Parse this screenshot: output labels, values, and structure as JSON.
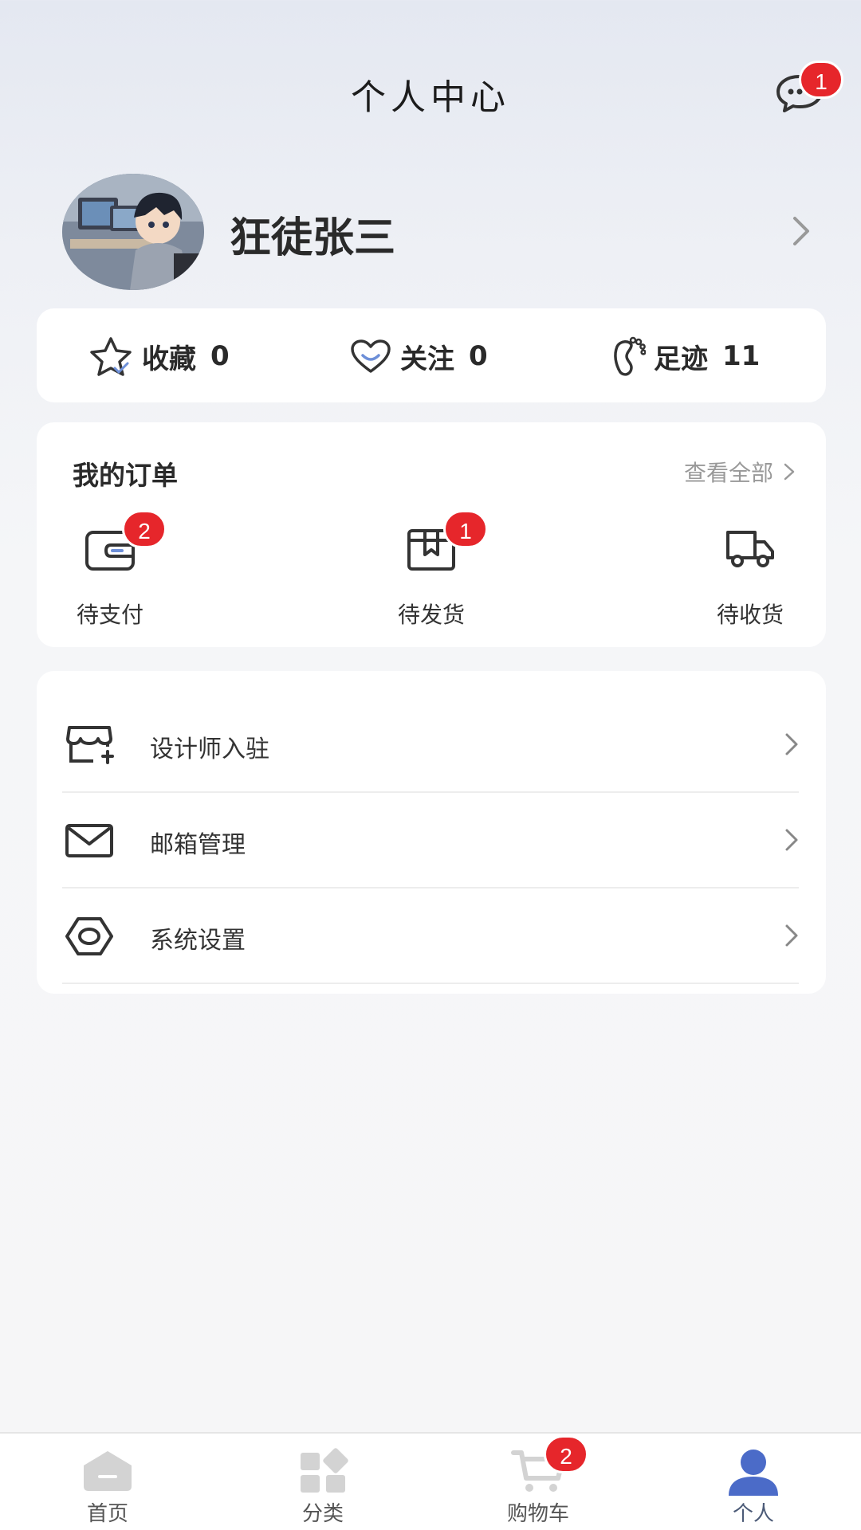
{
  "header": {
    "title": "个人中心",
    "message_badge": "1"
  },
  "profile": {
    "username": "狂徒张三"
  },
  "stats": [
    {
      "label": "收藏",
      "value": "0",
      "icon": "star-icon"
    },
    {
      "label": "关注",
      "value": "0",
      "icon": "heart-icon"
    },
    {
      "label": "足迹",
      "value": "11",
      "icon": "footprint-icon"
    }
  ],
  "orders": {
    "title": "我的订单",
    "view_all": "查看全部",
    "items": [
      {
        "label": "待支付",
        "badge": "2",
        "icon": "wallet-icon"
      },
      {
        "label": "待发货",
        "badge": "1",
        "icon": "package-icon"
      },
      {
        "label": "待收货",
        "icon": "truck-icon"
      }
    ]
  },
  "menu": [
    {
      "label": "设计师入驻",
      "icon": "store-add-icon"
    },
    {
      "label": "邮箱管理",
      "icon": "mail-icon"
    },
    {
      "label": "系统设置",
      "icon": "settings-icon"
    }
  ],
  "tabbar": {
    "items": [
      {
        "label": "首页",
        "icon": "home-icon"
      },
      {
        "label": "分类",
        "icon": "category-icon"
      },
      {
        "label": "购物车",
        "icon": "cart-icon",
        "badge": "2"
      },
      {
        "label": "个人",
        "icon": "user-icon"
      }
    ]
  },
  "colors": {
    "badge": "#e6262b",
    "active_tab": "#4b6bc8",
    "inactive_icon": "#d0d0d0"
  }
}
